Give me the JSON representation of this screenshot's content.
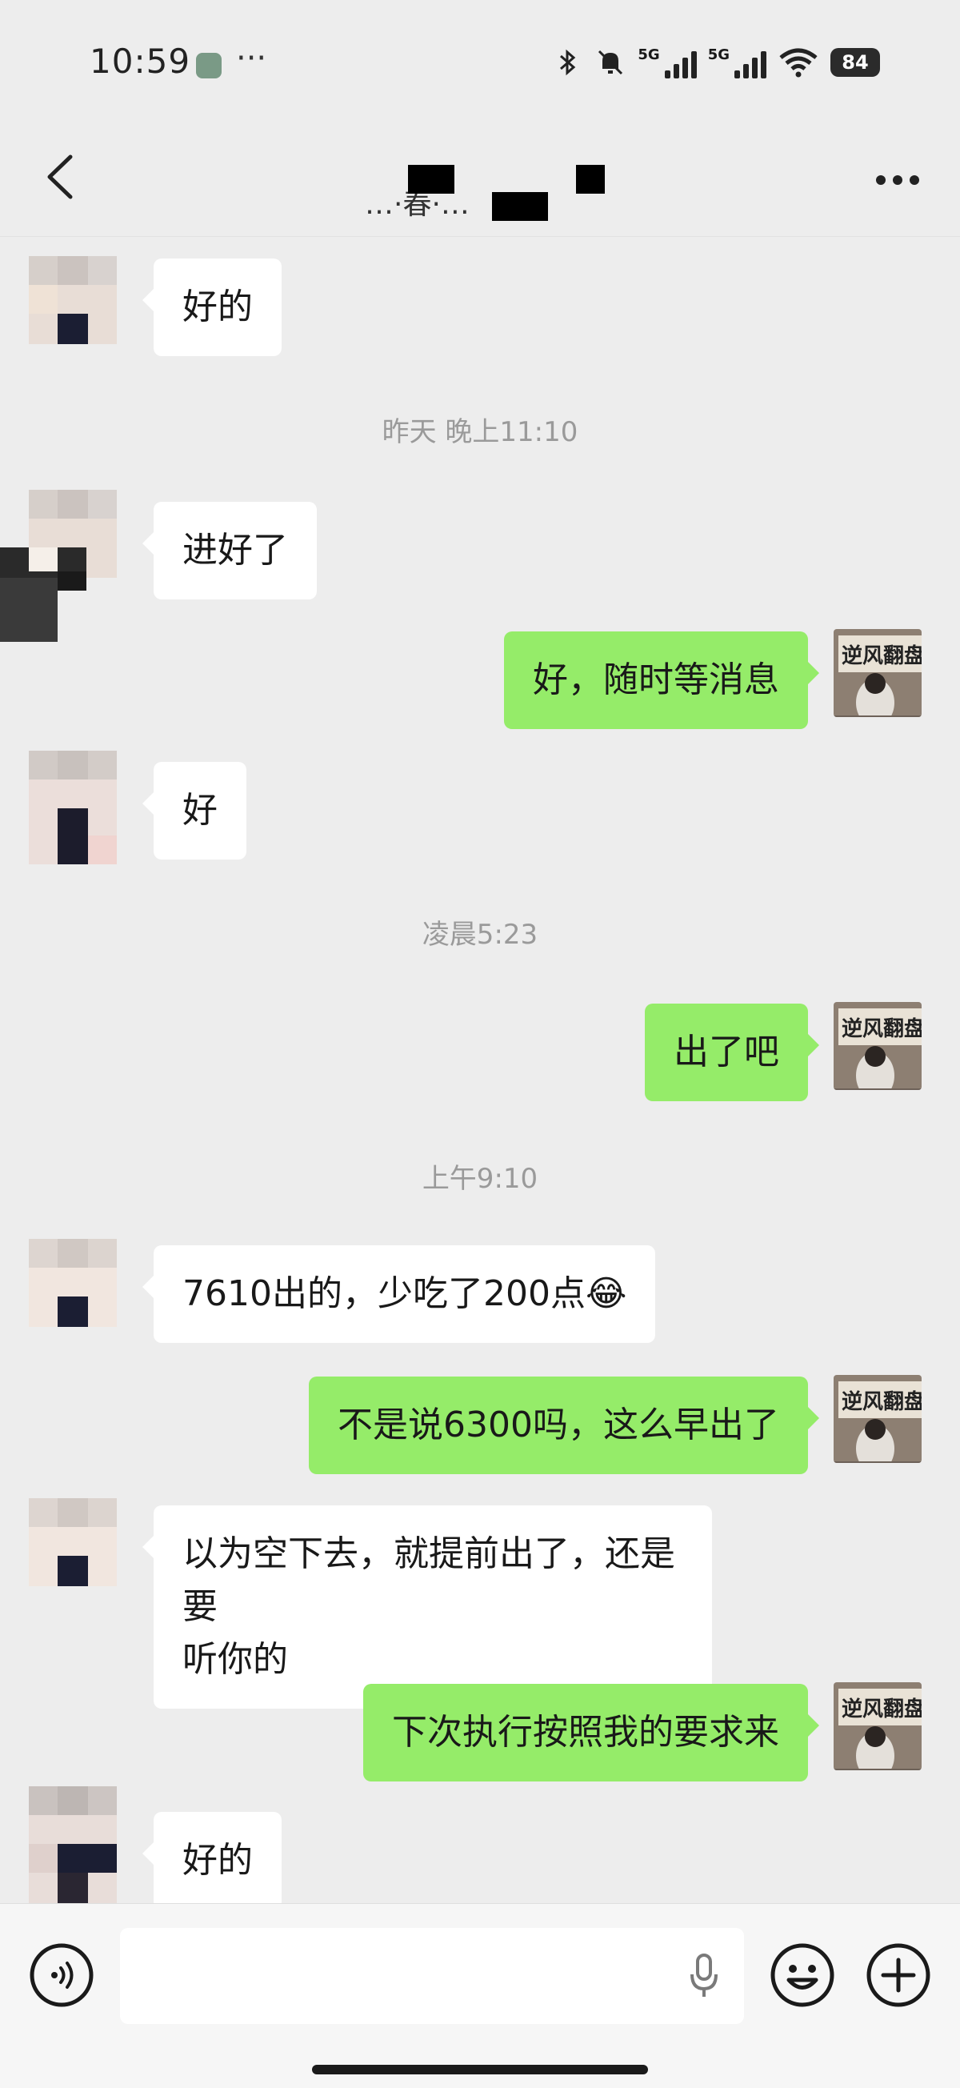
{
  "status_bar": {
    "time": "10:59",
    "dots": "···",
    "net1": "5G",
    "net2": "5G",
    "battery": "84"
  },
  "header": {
    "title": "…·春·…",
    "back_icon": "chevron-left-icon",
    "more_icon": "more-horizontal-icon"
  },
  "messages": [
    {
      "type": "in",
      "text": "好的"
    },
    {
      "type": "time",
      "text": "昨天 晚上11:10"
    },
    {
      "type": "in",
      "text": "进好了"
    },
    {
      "type": "out",
      "text": "好，随时等消息"
    },
    {
      "type": "in",
      "text": "好"
    },
    {
      "type": "time",
      "text": "凌晨5:23"
    },
    {
      "type": "out",
      "text": "出了吧"
    },
    {
      "type": "time",
      "text": "上午9:10"
    },
    {
      "type": "in",
      "text": "7610出的，少吃了200点😂"
    },
    {
      "type": "out",
      "text": "不是说6300吗，这么早出了"
    },
    {
      "type": "in",
      "text": "以为空下去，就提前出了，还是要\n听你的"
    },
    {
      "type": "out",
      "text": "下次执行按照我的要求来"
    },
    {
      "type": "in",
      "text": "好的"
    }
  ],
  "self_avatar_text": "逆风翻盘",
  "input_bar": {
    "placeholder": "",
    "voice_icon": "voice-icon",
    "mic_icon": "microphone-icon",
    "emoji_icon": "emoji-icon",
    "plus_icon": "plus-circle-icon"
  },
  "colors": {
    "background": "#ededed",
    "outgoing_bubble": "#95ec69",
    "incoming_bubble": "#ffffff",
    "timestamp": "#9a9a9a"
  }
}
